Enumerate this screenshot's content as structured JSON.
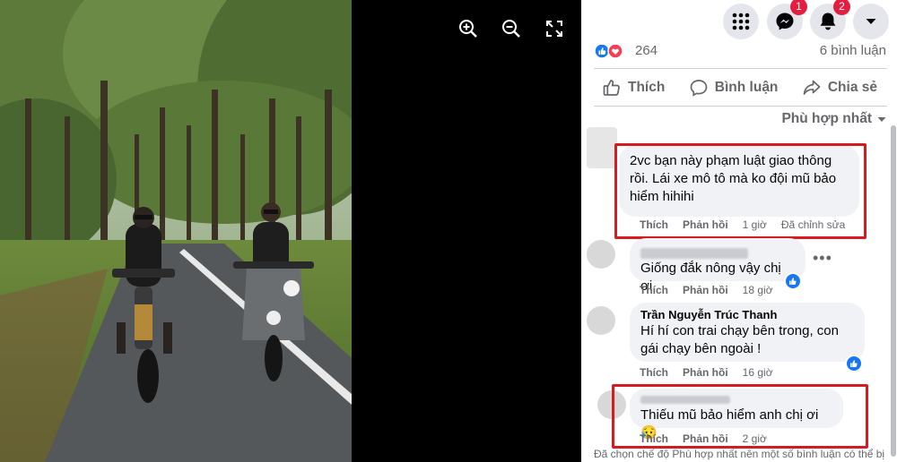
{
  "viewer": {
    "tools": [
      "zoom-in-icon",
      "zoom-out-icon",
      "fullscreen-icon"
    ]
  },
  "topbar": {
    "messenger_badge": "1",
    "notifications_badge": "2"
  },
  "post_stats": {
    "reactions_count": "264",
    "comments_count": "6 bình luận"
  },
  "actions": {
    "like": "Thích",
    "comment": "Bình luận",
    "share": "Chia sẻ"
  },
  "sort": {
    "label": "Phù hợp nhất"
  },
  "comments": [
    {
      "author": "",
      "text": "2vc bạn này phạm luật giao thông rồi. Lái xe mô tô mà ko đội mũ bảo hiểm hihihi",
      "like": "Thích",
      "reply": "Phản hồi",
      "time": "1 giờ",
      "edited": "Đã chỉnh sửa"
    },
    {
      "author": "",
      "text": "Giống đắk nông vậy chị ơi",
      "like": "Thích",
      "reply": "Phản hồi",
      "time": "18 giờ"
    },
    {
      "author": "Trần Nguyễn Trúc Thanh",
      "text": "Hí hí con trai chạy bên trong, con gái chạy bên ngoài !",
      "like": "Thích",
      "reply": "Phản hồi",
      "time": "16 giờ"
    },
    {
      "author": "",
      "text": "Thiếu mũ bảo hiểm anh chị ơi😥",
      "like": "Thích",
      "reply": "Phản hồi",
      "time": "2 giờ"
    }
  ],
  "footer_note": "Đã chọn chế độ Phù hợp nhất nên một số bình luận có thể bị",
  "colors": {
    "facebook_blue": "#1877f2",
    "highlight_red": "#d71920",
    "badge_red": "#e41e3f"
  }
}
